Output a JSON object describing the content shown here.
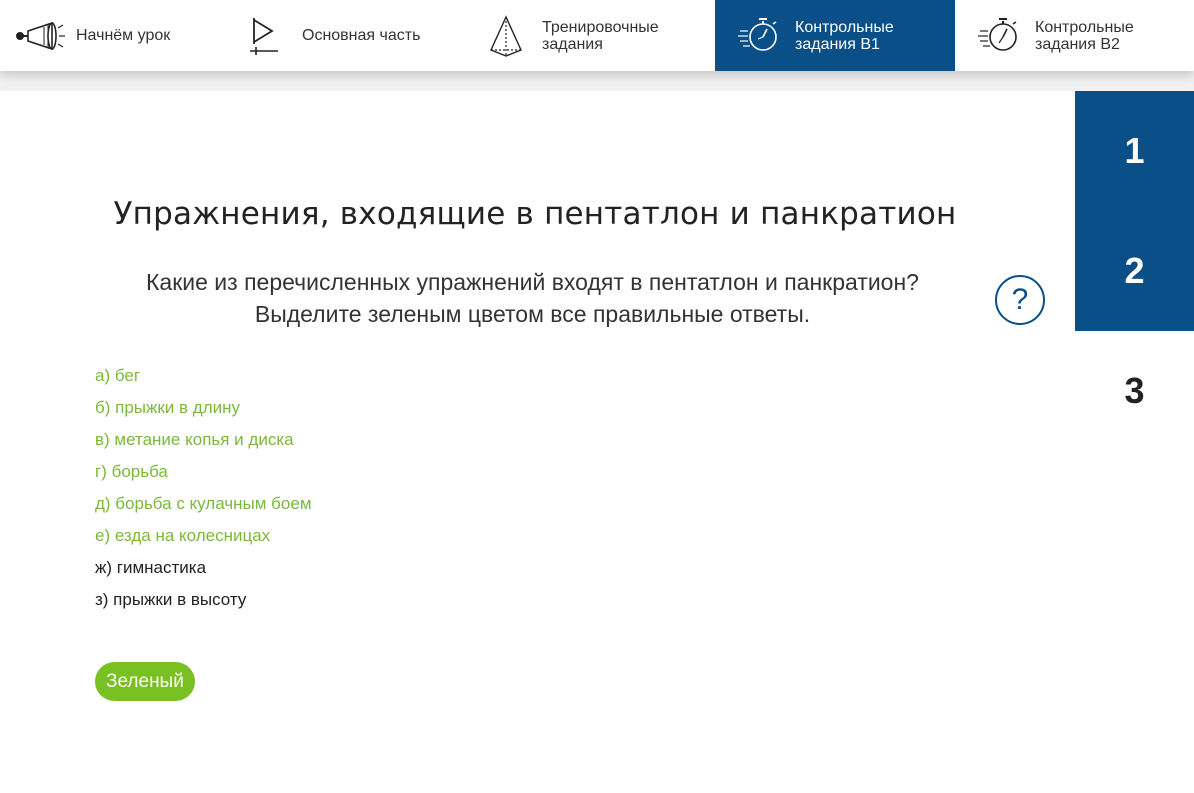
{
  "nav": {
    "tabs": [
      {
        "label": "Начнём урок",
        "icon": "megaphone-icon",
        "active": false
      },
      {
        "label": "Основная часть",
        "icon": "play-icon",
        "active": false
      },
      {
        "label": "Тренировочные\nзадания",
        "icon": "pyramid-icon",
        "active": false
      },
      {
        "label": "Контрольные\nзадания В1",
        "icon": "stopwatch-icon",
        "active": true
      },
      {
        "label": "Контрольные\nзадания В2",
        "icon": "stopwatch-icon",
        "active": false
      }
    ]
  },
  "side_nav": {
    "items": [
      "1",
      "2",
      "3"
    ],
    "current": "3"
  },
  "task": {
    "title": "Упражнения, входящие в пентатлон и панкратион",
    "question_line1": "Какие из перечисленных упражнений входят в пентатлон и панкратион?",
    "question_line2": "Выделите зеленым цветом все правильные ответы.",
    "help_label": "?",
    "answers": [
      {
        "text": "а) бег",
        "highlighted": true
      },
      {
        "text": "б) прыжки в длину",
        "highlighted": true
      },
      {
        "text": "в) метание копья и диска",
        "highlighted": true
      },
      {
        "text": "г) борьба",
        "highlighted": true
      },
      {
        "text": "д) борьба с кулачным боем",
        "highlighted": true
      },
      {
        "text": "е) езда на колесницах",
        "highlighted": true
      },
      {
        "text": "ж) гимнастика",
        "highlighted": false
      },
      {
        "text": "з) прыжки в высоту",
        "highlighted": false
      }
    ],
    "color_button_label": "Зеленый"
  },
  "colors": {
    "accent": "#0a4f88",
    "green_text": "#7ab93a",
    "green_button": "#79c023"
  }
}
